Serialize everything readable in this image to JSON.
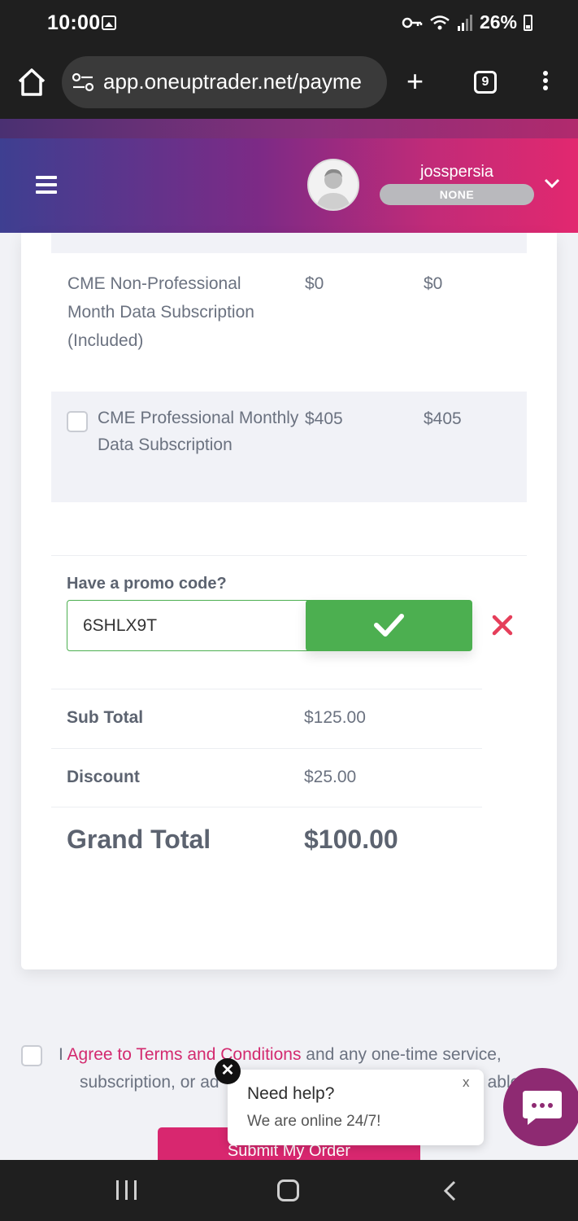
{
  "status_bar": {
    "time": "10:00",
    "battery": "26%"
  },
  "browser": {
    "url": "app.oneuptrader.net/payme",
    "tab_count": "9",
    "new_tab_label": "+"
  },
  "header": {
    "username": "josspersia",
    "plan": "NONE"
  },
  "subscriptions": [
    {
      "name": "CME Non-Professional Month Data Subscription (Included)",
      "price": "$0",
      "total": "$0",
      "selectable": false
    },
    {
      "name": "CME Professional Monthly Data Subscription",
      "price": "$405",
      "total": "$405",
      "selectable": true,
      "checked": false
    }
  ],
  "promo": {
    "label": "Have a promo code?",
    "value": "6SHLX9T"
  },
  "summary": {
    "subtotal_label": "Sub Total",
    "subtotal": "$125.00",
    "discount_label": "Discount",
    "discount": "$25.00",
    "grand_label": "Grand Total",
    "grand": "$100.00"
  },
  "agreement": {
    "prefix": "I ",
    "link": "Agree to Terms and Conditions",
    "suffix": " and any one-time service,",
    "line2": "subscription, or ad",
    "line2_end": "able"
  },
  "submit_label": "Submit My Order",
  "chat": {
    "title": "Need help?",
    "subtitle": "We are online 24/7!",
    "close_label": "x",
    "dismiss_label": "✕"
  },
  "colors": {
    "accent": "#d32a6f",
    "success": "#4caf50",
    "danger": "#e53e5a"
  }
}
